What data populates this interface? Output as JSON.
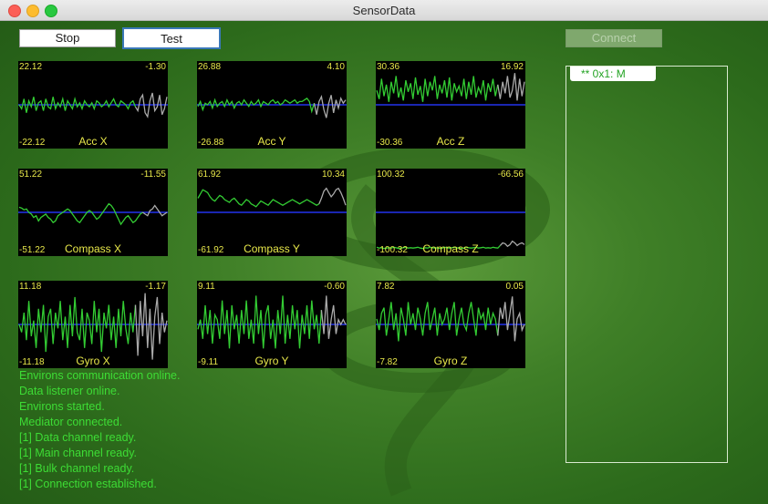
{
  "window": {
    "title": "SensorData"
  },
  "toolbar": {
    "stop_label": "Stop",
    "test_label": "Test",
    "connect_label": "Connect"
  },
  "device_list": {
    "items": [
      {
        "label": "** 0x1: M"
      }
    ]
  },
  "log": {
    "lines": [
      "Environs communication online.",
      "Data listener online.",
      "Environs started.",
      "Mediator connected.",
      "[1] Data channel ready.",
      "[1] Main channel ready.",
      "[1] Bulk channel  ready.",
      "[1] Connection established."
    ]
  },
  "colors": {
    "trace": "#33cc33",
    "recent_trace": "#aaaaaa",
    "zero_line": "#2233ee",
    "label": "#e8e84a",
    "log_text": "#3ddc35"
  },
  "chart_data": [
    {
      "type": "line",
      "title": "Acc X",
      "max_label": "22.12",
      "min_label": "-22.12",
      "last_label": "-1.30",
      "ylim": [
        -22.12,
        22.12
      ],
      "recent_fraction": 0.22,
      "values": [
        0,
        -2,
        3,
        -4,
        2,
        -1,
        4,
        -3,
        1,
        2,
        -3,
        3,
        -1,
        -2,
        4,
        -2,
        1,
        -1,
        3,
        -3,
        2,
        0,
        -2,
        3,
        -1,
        1,
        -2,
        2,
        0,
        -1,
        1,
        -2,
        2,
        1,
        -1,
        0,
        2,
        -1,
        1,
        3,
        0,
        -1,
        2,
        1,
        0,
        -2,
        1,
        2,
        -1,
        -3,
        3,
        5,
        -4,
        -6,
        2,
        6,
        -3,
        -1,
        5,
        -5,
        -2,
        4
      ]
    },
    {
      "type": "line",
      "title": "Acc Y",
      "max_label": "26.88",
      "min_label": "-26.88",
      "last_label": "4.10",
      "ylim": [
        -26.88,
        26.88
      ],
      "recent_fraction": 0.22,
      "values": [
        -1,
        2,
        -3,
        1,
        0,
        2,
        -2,
        3,
        -1,
        1,
        2,
        -1,
        3,
        0,
        2,
        -2,
        1,
        2,
        0,
        3,
        1,
        -1,
        2,
        0,
        1,
        3,
        -1,
        2,
        1,
        0,
        2,
        3,
        1,
        2,
        0,
        1,
        3,
        2,
        1,
        2,
        3,
        1,
        2,
        2,
        3,
        4,
        2,
        -4,
        1,
        -6,
        2,
        5,
        -3,
        -8,
        1,
        6,
        -5,
        3,
        -2,
        4,
        1,
        3
      ]
    },
    {
      "type": "line",
      "title": "Acc Z",
      "max_label": "30.36",
      "min_label": "-30.36",
      "last_label": "16.92",
      "ylim": [
        -30.36,
        30.36
      ],
      "recent_fraction": 0.2,
      "values": [
        10,
        4,
        18,
        6,
        14,
        2,
        16,
        8,
        20,
        5,
        12,
        3,
        17,
        9,
        15,
        4,
        19,
        7,
        13,
        2,
        18,
        6,
        16,
        10,
        20,
        4,
        14,
        8,
        17,
        5,
        19,
        3,
        15,
        9,
        13,
        6,
        18,
        4,
        16,
        7,
        20,
        5,
        12,
        8,
        17,
        3,
        15,
        9,
        18,
        6,
        14,
        4,
        16,
        8,
        20,
        5,
        10,
        22,
        3,
        18,
        6,
        16
      ]
    },
    {
      "type": "line",
      "title": "Compass X",
      "max_label": "51.22",
      "min_label": "-51.22",
      "last_label": "-11.55",
      "ylim": [
        -51.22,
        51.22
      ],
      "recent_fraction": 0.18,
      "values": [
        6,
        5,
        3,
        4,
        0,
        -2,
        -6,
        -4,
        -10,
        -6,
        -4,
        -2,
        -6,
        -8,
        -12,
        -10,
        -4,
        -2,
        0,
        2,
        4,
        2,
        -2,
        -6,
        -10,
        -12,
        -8,
        -4,
        0,
        2,
        0,
        -4,
        -8,
        -6,
        -2,
        2,
        6,
        10,
        8,
        4,
        -2,
        -8,
        -14,
        -10,
        -6,
        -4,
        -8,
        -12,
        -10,
        -6,
        -2,
        0,
        -2,
        -4,
        2,
        4,
        8,
        4,
        0,
        -4,
        -2,
        0
      ]
    },
    {
      "type": "line",
      "title": "Compass Y",
      "max_label": "61.92",
      "min_label": "-61.92",
      "last_label": "10.34",
      "ylim": [
        -61.92,
        61.92
      ],
      "recent_fraction": 0.2,
      "values": [
        20,
        26,
        32,
        30,
        28,
        22,
        18,
        16,
        20,
        24,
        22,
        18,
        16,
        14,
        18,
        20,
        16,
        12,
        10,
        14,
        18,
        16,
        12,
        10,
        8,
        12,
        16,
        14,
        12,
        10,
        14,
        18,
        16,
        14,
        12,
        10,
        12,
        14,
        16,
        18,
        16,
        14,
        12,
        14,
        16,
        18,
        16,
        14,
        12,
        10,
        12,
        20,
        30,
        34,
        28,
        22,
        26,
        32,
        34,
        28,
        20,
        10
      ]
    },
    {
      "type": "line",
      "title": "Compass Z",
      "max_label": "100.32",
      "min_label": "-100.32",
      "last_label": "-66.56",
      "ylim": [
        -100.32,
        100.32
      ],
      "recent_fraction": 0.18,
      "values": [
        -80,
        -82,
        -81,
        -83,
        -82,
        -81,
        -82,
        -80,
        -81,
        -83,
        -82,
        -81,
        -80,
        -82,
        -81,
        -82,
        -81,
        -80,
        -82,
        -83,
        -81,
        -82,
        -80,
        -81,
        -82,
        -81,
        -83,
        -82,
        -80,
        -81,
        -82,
        -81,
        -80,
        -82,
        -81,
        -83,
        -82,
        -80,
        -81,
        -82,
        -81,
        -80,
        -82,
        -81,
        -80,
        -82,
        -81,
        -82,
        -80,
        -81,
        -82,
        -76,
        -70,
        -72,
        -78,
        -74,
        -66,
        -70,
        -76,
        -72,
        -70,
        -74
      ]
    },
    {
      "type": "line",
      "title": "Gyro X",
      "max_label": "11.18",
      "min_label": "-11.18",
      "last_label": "-1.17",
      "ylim": [
        -11.18,
        11.18
      ],
      "recent_fraction": 0.22,
      "values": [
        0,
        -2,
        3,
        -4,
        6,
        -3,
        1,
        -6,
        4,
        -2,
        5,
        -7,
        2,
        4,
        -5,
        3,
        -1,
        6,
        -4,
        2,
        -6,
        5,
        -3,
        7,
        -2,
        -4,
        4,
        -6,
        3,
        1,
        -5,
        6,
        -2,
        4,
        -7,
        3,
        -1,
        5,
        -4,
        2,
        -6,
        4,
        -3,
        6,
        -1,
        -5,
        3,
        -2,
        5,
        -8,
        6,
        -3,
        8,
        -6,
        4,
        -9,
        2,
        7,
        -5,
        3,
        -2,
        1
      ]
    },
    {
      "type": "line",
      "title": "Gyro Y",
      "max_label": "9.11",
      "min_label": "-9.11",
      "last_label": "-0.60",
      "ylim": [
        -9.11,
        9.11
      ],
      "recent_fraction": 0.18,
      "values": [
        -1,
        1,
        -3,
        4,
        -2,
        3,
        -4,
        2,
        1,
        -3,
        5,
        -2,
        3,
        -5,
        4,
        -1,
        2,
        -4,
        3,
        -2,
        5,
        -3,
        1,
        -4,
        6,
        -2,
        3,
        -5,
        2,
        4,
        -3,
        1,
        -5,
        3,
        -2,
        6,
        -4,
        2,
        -3,
        4,
        -1,
        3,
        -5,
        2,
        -2,
        4,
        -3,
        5,
        -1,
        2,
        -4,
        3,
        -2,
        6,
        -3,
        1,
        4,
        -2,
        1,
        0,
        1,
        0
      ]
    },
    {
      "type": "line",
      "title": "Gyro Z",
      "max_label": "7.82",
      "min_label": "-7.82",
      "last_label": "0.05",
      "ylim": [
        -7.82,
        7.82
      ],
      "recent_fraction": 0.2,
      "values": [
        1,
        -1,
        2,
        3,
        -2,
        1,
        4,
        -1,
        2,
        -3,
        3,
        1,
        -2,
        4,
        0,
        2,
        -1,
        3,
        1,
        -2,
        2,
        4,
        -1,
        1,
        3,
        -2,
        2,
        0,
        1,
        3,
        -1,
        2,
        4,
        -2,
        1,
        3,
        0,
        -1,
        2,
        4,
        1,
        -2,
        3,
        1,
        2,
        -1,
        3,
        0,
        2,
        1,
        -2,
        3,
        1,
        4,
        -1,
        2,
        5,
        -3,
        1,
        2,
        -1,
        0
      ]
    }
  ]
}
